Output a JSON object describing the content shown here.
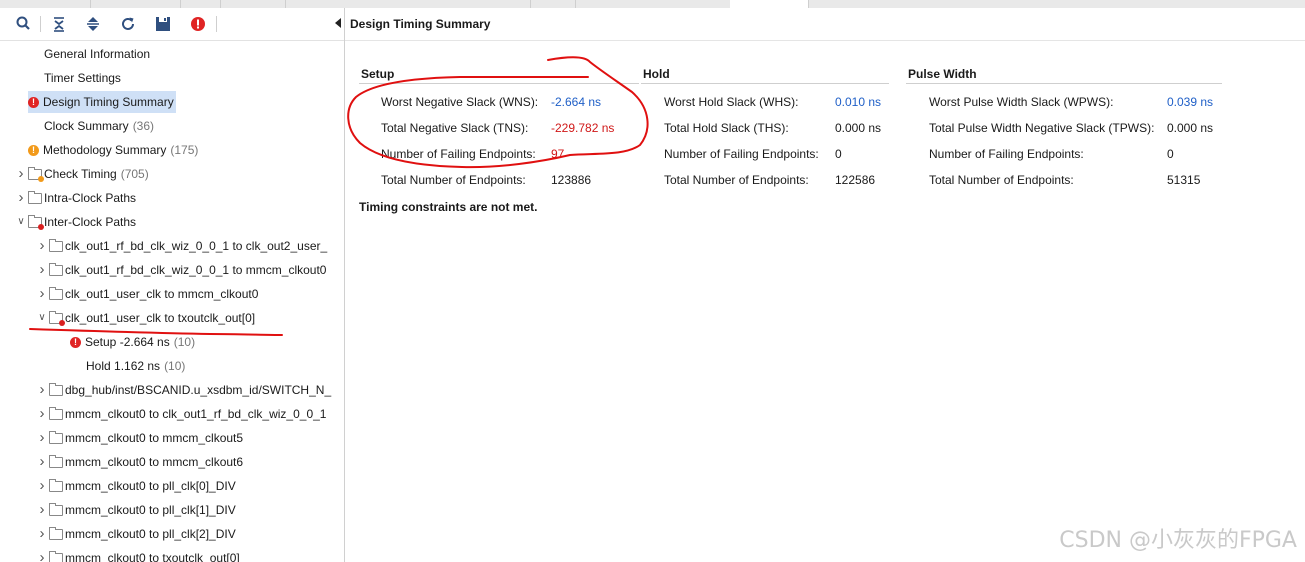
{
  "toolbar": {
    "icons": [
      "search-icon",
      "collapse-all-icon",
      "expand-all-icon",
      "refresh-icon",
      "save-icon",
      "error-icon"
    ]
  },
  "tree": [
    {
      "label": "General Information",
      "count": "",
      "status": "none"
    },
    {
      "label": "Timer Settings",
      "count": "",
      "status": "none"
    },
    {
      "label": "Design Timing Summary",
      "count": "",
      "status": "error",
      "selected": true
    },
    {
      "label": "Clock Summary",
      "count": "(36)",
      "status": "none"
    },
    {
      "label": "Methodology Summary",
      "count": "(175)",
      "status": "warning"
    },
    {
      "label": "Check Timing",
      "count": "(705)",
      "status": "folder-orange",
      "expand": "collapsed"
    },
    {
      "label": "Intra-Clock Paths",
      "count": "",
      "status": "folder",
      "expand": "collapsed"
    },
    {
      "label": "Inter-Clock Paths",
      "count": "",
      "status": "folder-red",
      "expand": "expanded"
    },
    {
      "label": "clk_out1_rf_bd_clk_wiz_0_0_1 to clk_out2_user_",
      "count": "",
      "status": "folder",
      "expand": "collapsed"
    },
    {
      "label": "clk_out1_rf_bd_clk_wiz_0_0_1 to mmcm_clkout0",
      "count": "",
      "status": "folder",
      "expand": "collapsed"
    },
    {
      "label": "clk_out1_user_clk to mmcm_clkout0",
      "count": "",
      "status": "folder",
      "expand": "collapsed"
    },
    {
      "label": "clk_out1_user_clk to txoutclk_out[0]",
      "count": "",
      "status": "folder-red",
      "expand": "expanded"
    },
    {
      "label": "Setup -2.664 ns",
      "count": "(10)",
      "status": "error"
    },
    {
      "label": "Hold 1.162 ns",
      "count": "(10)",
      "status": "none"
    },
    {
      "label": "dbg_hub/inst/BSCANID.u_xsdbm_id/SWITCH_N_",
      "count": "",
      "status": "folder",
      "expand": "collapsed"
    },
    {
      "label": "mmcm_clkout0 to clk_out1_rf_bd_clk_wiz_0_0_1",
      "count": "",
      "status": "folder",
      "expand": "collapsed"
    },
    {
      "label": "mmcm_clkout0 to mmcm_clkout5",
      "count": "",
      "status": "folder",
      "expand": "collapsed"
    },
    {
      "label": "mmcm_clkout0 to mmcm_clkout6",
      "count": "",
      "status": "folder",
      "expand": "collapsed"
    },
    {
      "label": "mmcm_clkout0 to pll_clk[0]_DIV",
      "count": "",
      "status": "folder",
      "expand": "collapsed"
    },
    {
      "label": "mmcm_clkout0 to pll_clk[1]_DIV",
      "count": "",
      "status": "folder",
      "expand": "collapsed"
    },
    {
      "label": "mmcm_clkout0 to pll_clk[2]_DIV",
      "count": "",
      "status": "folder",
      "expand": "collapsed"
    },
    {
      "label": "mmcm_clkout0 to txoutclk_out[0]",
      "count": "",
      "status": "folder",
      "expand": "collapsed"
    }
  ],
  "summary": {
    "title": "Design Timing Summary",
    "setup": {
      "heading": "Setup",
      "rows": [
        {
          "label": "Worst Negative Slack (WNS):",
          "value": "-2.664 ns",
          "color": "blue"
        },
        {
          "label": "Total Negative Slack (TNS):",
          "value": "-229.782 ns",
          "color": "red"
        },
        {
          "label": "Number of Failing Endpoints:",
          "value": "97",
          "color": "red"
        },
        {
          "label": "Total Number of Endpoints:",
          "value": "123886",
          "color": "black"
        }
      ]
    },
    "hold": {
      "heading": "Hold",
      "rows": [
        {
          "label": "Worst Hold Slack (WHS):",
          "value": "0.010 ns",
          "color": "blue"
        },
        {
          "label": "Total Hold Slack (THS):",
          "value": "0.000 ns",
          "color": "black"
        },
        {
          "label": "Number of Failing Endpoints:",
          "value": "0",
          "color": "black"
        },
        {
          "label": "Total Number of Endpoints:",
          "value": "122586",
          "color": "black"
        }
      ]
    },
    "pulse": {
      "heading": "Pulse Width",
      "rows": [
        {
          "label": "Worst Pulse Width Slack (WPWS):",
          "value": "0.039 ns",
          "color": "blue"
        },
        {
          "label": "Total Pulse Width Negative Slack (TPWS):",
          "value": "0.000 ns",
          "color": "black"
        },
        {
          "label": "Number of Failing Endpoints:",
          "value": "0",
          "color": "black"
        },
        {
          "label": "Total Number of Endpoints:",
          "value": "51315",
          "color": "black"
        }
      ]
    },
    "message": "Timing constraints are not met."
  },
  "watermark": "CSDN @小灰灰的FPGA",
  "colors": {
    "error": "#e02424",
    "warning": "#f29a1a",
    "link": "#1f5fc7",
    "annotation": "#e01010"
  }
}
